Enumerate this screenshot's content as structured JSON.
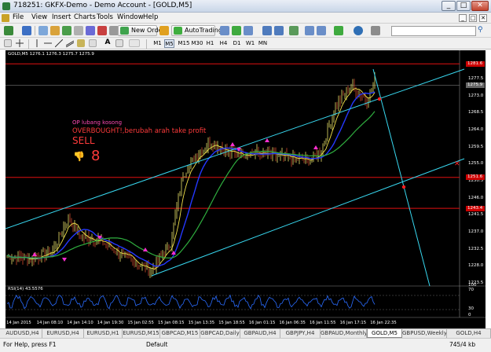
{
  "window": {
    "title": "718251: GKFX-Demo - Demo Account - [GOLD,M5]",
    "min_glyph": "_",
    "max_glyph": "□",
    "close_glyph": "✕"
  },
  "menu": {
    "items": [
      "File",
      "View",
      "Insert",
      "Charts",
      "Tools",
      "Window",
      "Help"
    ],
    "mdi_controls": [
      "_",
      "□",
      "✕"
    ]
  },
  "toolbar": {
    "new_order_label": "New Order",
    "autotrading_label": "AutoTrading",
    "timeframes": [
      "M1",
      "M5",
      "M15",
      "M30",
      "H1",
      "H4",
      "D1",
      "W1",
      "MN"
    ],
    "active_timeframe": "M5",
    "search_placeholder": ""
  },
  "chart": {
    "symbol_header": "GOLD,M5  1276.1 1276.3 1275.7 1275.9",
    "notes": {
      "line1": "OP lubang kosong",
      "line2": "OVERBOUGHT!,berubah arah take profit",
      "line3": "SELL",
      "thumb_glyph": "👎",
      "big_number": "8"
    },
    "price_axis": [
      {
        "label": "1277.5",
        "y": 1277.5
      },
      {
        "label": "1273.0",
        "y": 1273.0
      },
      {
        "label": "1268.5",
        "y": 1268.5
      },
      {
        "label": "1264.0",
        "y": 1264.0
      },
      {
        "label": "1259.5",
        "y": 1259.5
      },
      {
        "label": "1255.0",
        "y": 1255.0
      },
      {
        "label": "1250.5",
        "y": 1250.5
      },
      {
        "label": "1246.0",
        "y": 1246.0
      },
      {
        "label": "1241.5",
        "y": 1241.5
      },
      {
        "label": "1237.0",
        "y": 1237.0
      },
      {
        "label": "1232.5",
        "y": 1232.5
      },
      {
        "label": "1228.0",
        "y": 1228.0
      },
      {
        "label": "1223.5",
        "y": 1223.5
      }
    ],
    "price_tags": [
      {
        "label": "1281.6",
        "color": "#cc0000"
      },
      {
        "label": "1275.9",
        "color": "#666666"
      },
      {
        "label": "1251.6",
        "color": "#cc0000"
      },
      {
        "label": "1243.4",
        "color": "#cc0000"
      }
    ],
    "rsi": {
      "title": "RSI(14) 43.5576",
      "levels": [
        "70",
        "30"
      ],
      "scale_labels": [
        "100",
        "0"
      ]
    },
    "time_axis": [
      "14 Jan 2015",
      "14 Jan 08:10",
      "14 Jan 14:10",
      "14 Jan 19:30",
      "15 Jan 02:55",
      "15 Jan 08:15",
      "15 Jan 13:35",
      "15 Jan 18:55",
      "16 Jan 01:15",
      "16 Jan 06:35",
      "16 Jan 11:55",
      "16 Jan 17:15",
      "16 Jan 22:35"
    ],
    "colors": {
      "background": "#000000",
      "bull_candle": "#e9e26a",
      "bear_candle": "#d04a2c",
      "fast_ma": "#f2e24a",
      "mid_ma": "#2438ff",
      "slow_ma": "#2fae3f",
      "channel": "#38d8f0",
      "horizontal_levels": "#e01010",
      "arrows": "#ff2fd0",
      "rsi_line": "#2a6cff"
    }
  },
  "tabs": [
    "AUDUSD,H4",
    "EURUSD,H4",
    "EURUSD,H1",
    "EURUSD,M15",
    "GBPCAD,M15",
    "GBPCAD,Daily",
    "GBPAUD,H4",
    "GBPJPY,H4",
    "GBPAUD,Monthly",
    "GOLD,M5",
    "GBPUSD,Weekly",
    "GOLD,H4"
  ],
  "active_tab": "GOLD,M5",
  "status": {
    "left": "For Help, press F1",
    "middle": "Default",
    "right": "745/4 kb"
  }
}
